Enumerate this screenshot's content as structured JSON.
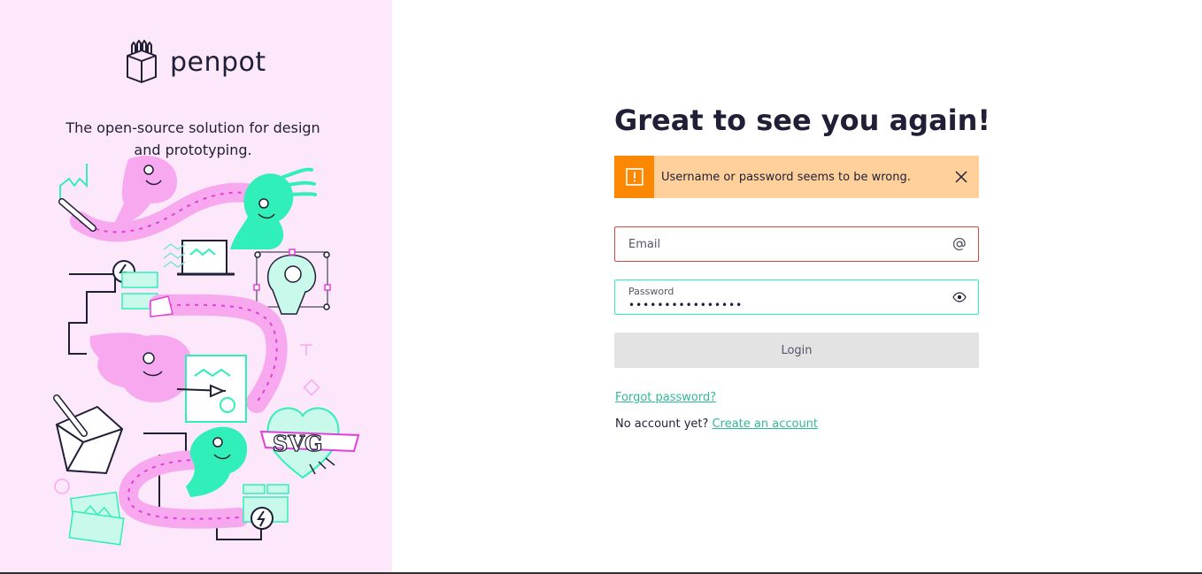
{
  "brand": {
    "name": "penpot",
    "tagline": "The open-source solution for design and prototyping."
  },
  "login": {
    "title": "Great to see you again!",
    "alert": {
      "message": "Username or password seems to be wrong.",
      "icon": "warning-icon",
      "close_icon": "close-icon"
    },
    "email": {
      "placeholder": "Email",
      "value": "",
      "icon": "at-icon"
    },
    "password": {
      "label": "Password",
      "value": "••••••••••••••••",
      "icon": "eye-icon"
    },
    "submit_label": "Login",
    "forgot_password": "Forgot password?",
    "no_account_text": "No account yet?",
    "create_account": "Create an account"
  },
  "colors": {
    "left_panel_bg": "#fde8fb",
    "alert_bg": "#ffd09a",
    "alert_accent": "#fc8802",
    "error_border": "#d8493f",
    "focus_border": "#31efb8",
    "link": "#31b89a",
    "button_disabled_bg": "#e3e3e3",
    "illustration_pink": "#f7a8ee",
    "illustration_green": "#31efb8"
  }
}
